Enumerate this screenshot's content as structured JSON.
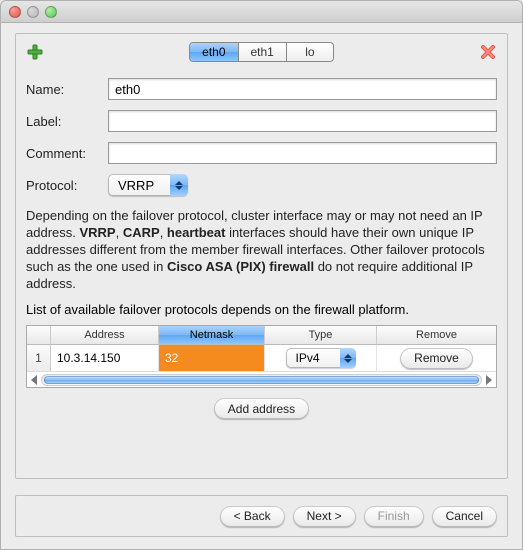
{
  "tabs": {
    "items": [
      "eth0",
      "eth1",
      "lo"
    ],
    "active": "eth0"
  },
  "toolbar": {
    "add_icon": "plus-icon",
    "remove_icon": "x-icon"
  },
  "form": {
    "name_label": "Name:",
    "name_value": "eth0",
    "label_label": "Label:",
    "label_value": "",
    "comment_label": "Comment:",
    "comment_value": "",
    "protocol_label": "Protocol:",
    "protocol_value": "VRRP"
  },
  "description": {
    "p1_prefix": "Depending on the failover protocol, cluster interface may or may not need an IP address. ",
    "b1": "VRRP",
    "sep1": ", ",
    "b2": "CARP",
    "sep2": ", ",
    "b3": "heartbeat",
    "p1_mid": " interfaces should have their own unique IP addresses different from the member firewall interfaces. Other failover protocols such as the one used in ",
    "b4": "Cisco ASA (PIX) firewall",
    "p1_suffix": " do not require additional IP address.",
    "p2": "List of available failover protocols depends on the firewall platform."
  },
  "table": {
    "headers": {
      "address": "Address",
      "netmask": "Netmask",
      "type": "Type",
      "remove": "Remove"
    },
    "rows": [
      {
        "n": "1",
        "address": "10.3.14.150",
        "netmask": "32",
        "type": "IPv4",
        "remove_label": "Remove"
      }
    ]
  },
  "add_address_label": "Add address",
  "buttons": {
    "back": "< Back",
    "next": "Next >",
    "finish": "Finish",
    "cancel": "Cancel"
  }
}
